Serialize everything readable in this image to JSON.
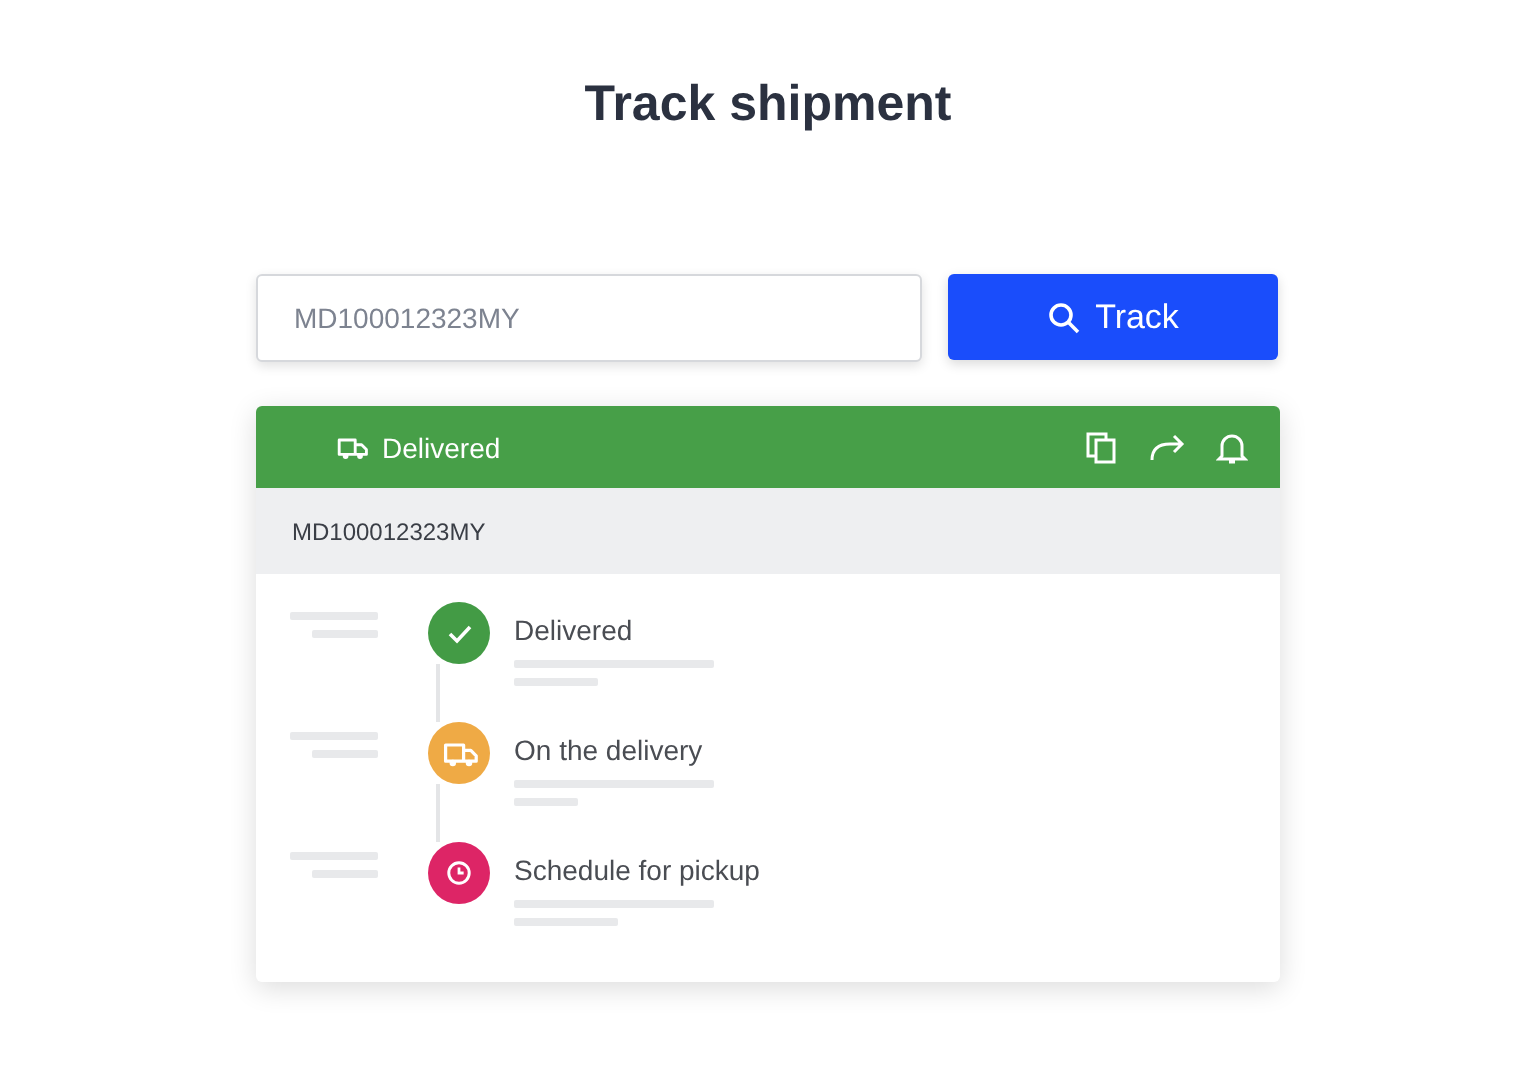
{
  "title": "Track shipment",
  "search": {
    "value": "MD100012323MY",
    "button": "Track"
  },
  "result": {
    "status": "Delivered",
    "tracking_number": "MD100012323MY",
    "steps": [
      {
        "kind": "check",
        "label": "Delivered",
        "color": "#439b45"
      },
      {
        "kind": "truck",
        "label": "On the delivery",
        "color": "#efaa45"
      },
      {
        "kind": "clock",
        "label": "Schedule for pickup",
        "color": "#dd2566"
      }
    ]
  }
}
